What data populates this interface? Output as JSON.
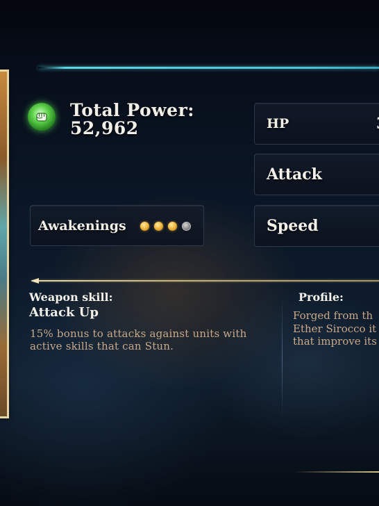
{
  "total_power": {
    "title": "Total Power:",
    "value": "52,962"
  },
  "stats": [
    {
      "label": "HP",
      "value": "3"
    },
    {
      "label": "Attack",
      "value": ""
    },
    {
      "label": "Speed",
      "value": ""
    }
  ],
  "awakenings": {
    "label": "Awakenings",
    "filled": 3,
    "total": 4
  },
  "weapon_skill": {
    "heading": "Weapon skill:",
    "name": "Attack Up",
    "description": "15% bonus to attacks against units with active skills that can Stun."
  },
  "profile": {
    "heading": "Profile:",
    "lines": [
      "Forged from th",
      "Ether Sirocco it",
      "that improve its"
    ]
  },
  "colors": {
    "accent_cyan": "#5fd6e6",
    "gold_divider": "#e9d8a6",
    "power_green": "#5fd34c",
    "description_text": "#c9a98a"
  },
  "icons": {
    "power": "fist-icon"
  }
}
